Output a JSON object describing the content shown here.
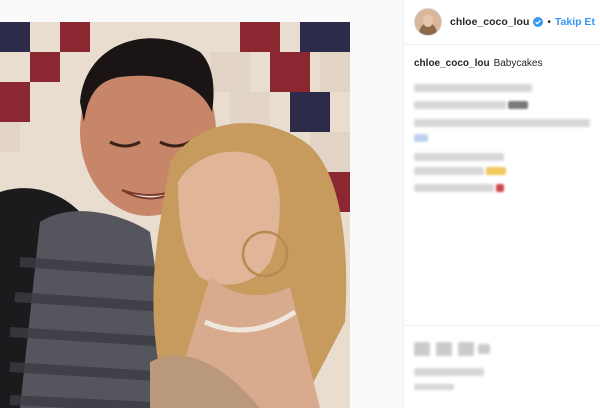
{
  "header": {
    "username": "chloe_coco_lou",
    "separator": "•",
    "follow_label": "Takip Et"
  },
  "caption": {
    "username": "chloe_coco_lou",
    "text": "Babycakes"
  },
  "colors": {
    "accent": "#3897f0",
    "verified": "#3897f0",
    "text": "#262626",
    "border": "#efefef"
  },
  "icons": {
    "verified": "verified-badge-icon",
    "like": "heart-icon",
    "comment": "comment-icon",
    "share": "share-icon"
  }
}
